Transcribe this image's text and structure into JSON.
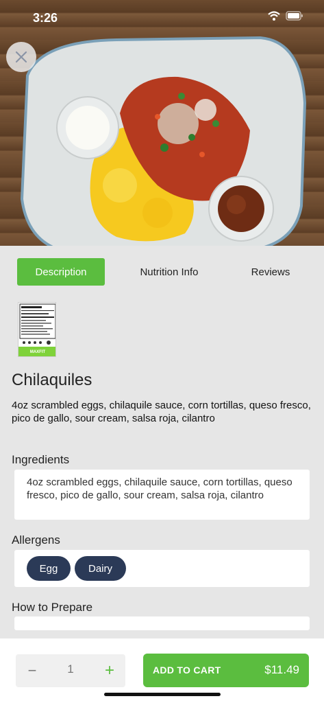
{
  "status_bar": {
    "time": "3:26",
    "icons": [
      "wifi-icon",
      "battery-icon"
    ]
  },
  "hero": {
    "image": "chilaquiles-plate-photo",
    "close_icon": "close-icon"
  },
  "tabs": [
    {
      "label": "Description",
      "active": true
    },
    {
      "label": "Nutrition Info",
      "active": false
    },
    {
      "label": "Reviews",
      "active": false
    }
  ],
  "nutrition_label": {
    "brand": "MAXFIT"
  },
  "product": {
    "title": "Chilaquiles",
    "description": "4oz scrambled eggs, chilaquile sauce, corn tortillas, queso fresco, pico de gallo, sour cream, salsa roja, cilantro"
  },
  "ingredients": {
    "heading": "Ingredients",
    "text": "4oz scrambled eggs, chilaquile sauce, corn tortillas, queso fresco, pico de gallo, sour cream, salsa roja, cilantro"
  },
  "allergens": {
    "heading": "Allergens",
    "items": [
      "Egg",
      "Dairy"
    ]
  },
  "prepare": {
    "heading": "How to Prepare"
  },
  "cart": {
    "minus": "−",
    "quantity": "1",
    "plus": "+",
    "add_label": "ADD TO CART",
    "price": "$11.49"
  },
  "colors": {
    "accent": "#5bbd3f",
    "chip": "#2b3a57",
    "background": "#e6e6e6"
  }
}
